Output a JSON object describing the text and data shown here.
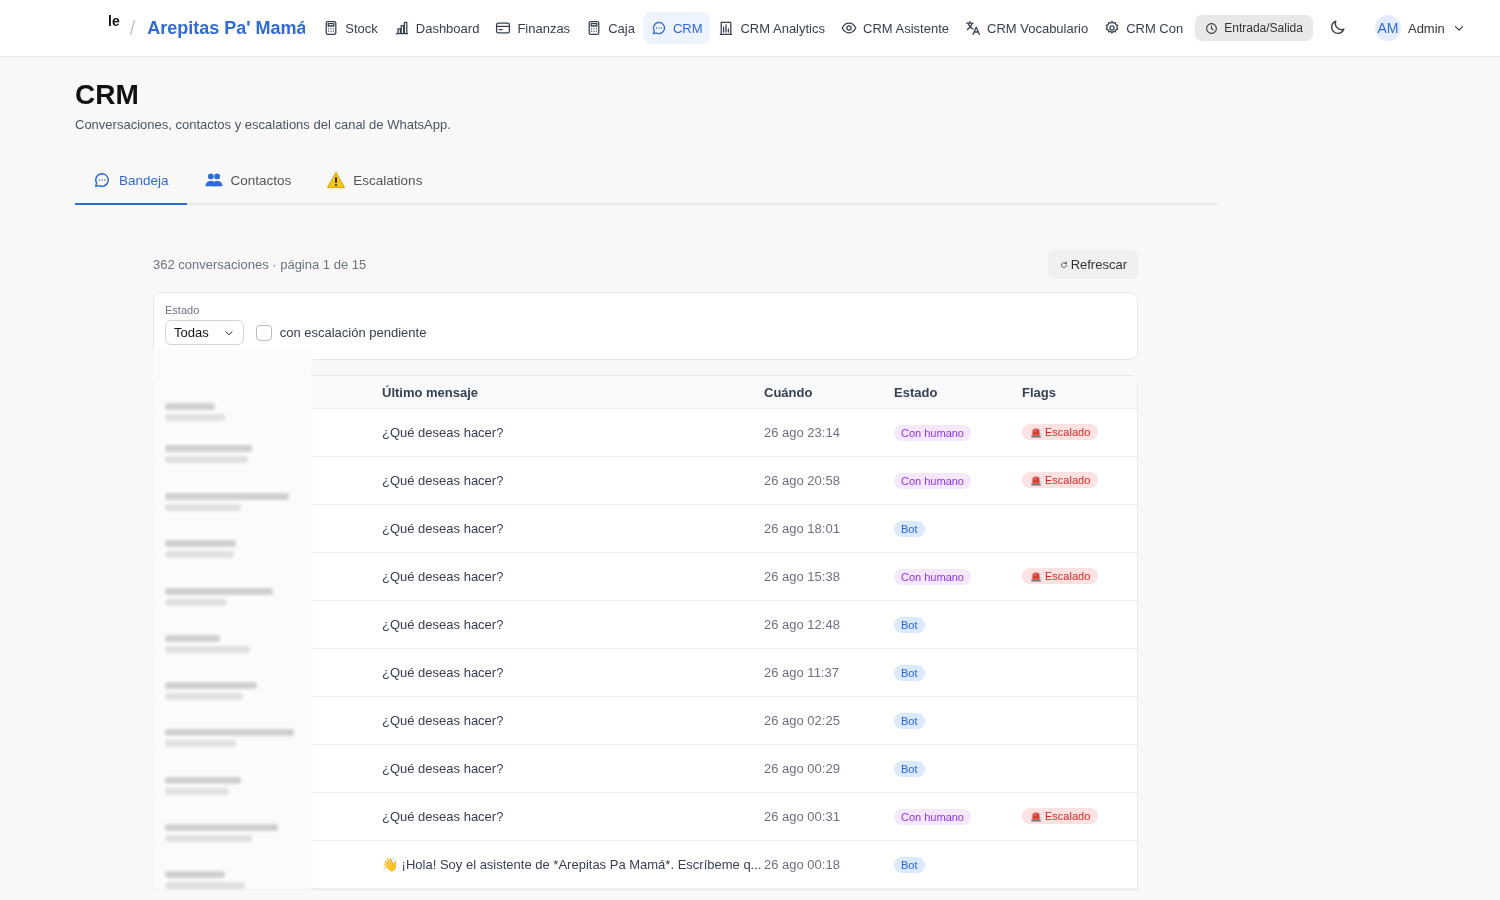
{
  "topbar": {
    "logo_text": "le",
    "separator": "/",
    "brand": "Arepitas Pa' Mamá",
    "nav": [
      {
        "label": "Stock",
        "selected": false
      },
      {
        "label": "Dashboard",
        "selected": false
      },
      {
        "label": "Finanzas",
        "selected": false
      },
      {
        "label": "Caja",
        "selected": false
      },
      {
        "label": "CRM",
        "selected": true
      },
      {
        "label": "CRM Analytics",
        "selected": false
      },
      {
        "label": "CRM Asistente",
        "selected": false
      },
      {
        "label": "CRM Vocabulario",
        "selected": false
      },
      {
        "label": "CRM Con",
        "selected": false
      }
    ],
    "clock_button": "Entrada/Salida",
    "user": {
      "initials": "AM",
      "name": "Admin"
    }
  },
  "page": {
    "title": "CRM",
    "subtitle": "Conversaciones, contactos y escalations del canal de WhatsApp."
  },
  "tabs": [
    {
      "label": "Bandeja",
      "selected": true
    },
    {
      "label": "Contactos",
      "selected": false
    },
    {
      "label": "Escalations",
      "selected": false
    }
  ],
  "summary": "362 conversaciones · página 1 de 15",
  "refresh_button": "Refrescar",
  "filters": {
    "estado_label": "Estado",
    "estado_value": "Todas",
    "pending_only": {
      "label": "con escalación pendiente",
      "checked": false
    }
  },
  "table": {
    "columns": [
      "Último mensaje",
      "Cuándo",
      "Estado",
      "Flags"
    ],
    "rows": [
      {
        "message": "¿Qué deseas hacer?",
        "when": "26 ago 23:14",
        "status": {
          "kind": "human",
          "label": "Con humano"
        },
        "flag": "Escalado"
      },
      {
        "message": "¿Qué deseas hacer?",
        "when": "26 ago 20:58",
        "status": {
          "kind": "human",
          "label": "Con humano"
        },
        "flag": "Escalado"
      },
      {
        "message": "¿Qué deseas hacer?",
        "when": "26 ago 18:01",
        "status": {
          "kind": "bot",
          "label": "Bot"
        }
      },
      {
        "message": "¿Qué deseas hacer?",
        "when": "26 ago 15:38",
        "status": {
          "kind": "human",
          "label": "Con humano"
        },
        "flag": "Escalado"
      },
      {
        "message": "¿Qué deseas hacer?",
        "when": "26 ago 12:48",
        "status": {
          "kind": "bot",
          "label": "Bot"
        }
      },
      {
        "message": "¿Qué deseas hacer?",
        "when": "26 ago 11:37",
        "status": {
          "kind": "bot",
          "label": "Bot"
        }
      },
      {
        "message": "¿Qué deseas hacer?",
        "when": "26 ago 02:25",
        "status": {
          "kind": "bot",
          "label": "Bot"
        }
      },
      {
        "message": "¿Qué deseas hacer?",
        "when": "26 ago 00:29",
        "status": {
          "kind": "bot",
          "label": "Bot"
        }
      },
      {
        "message": "¿Qué deseas hacer?",
        "when": "26 ago 00:31",
        "status": {
          "kind": "human",
          "label": "Con humano"
        },
        "flag": "Escalado"
      },
      {
        "message": "👋 ¡Hola! Soy el asistente de *Arepitas Pa Mamá*. Escríbeme q...",
        "when": "26 ago 00:18",
        "status": {
          "kind": "bot",
          "label": "Bot"
        }
      }
    ]
  }
}
